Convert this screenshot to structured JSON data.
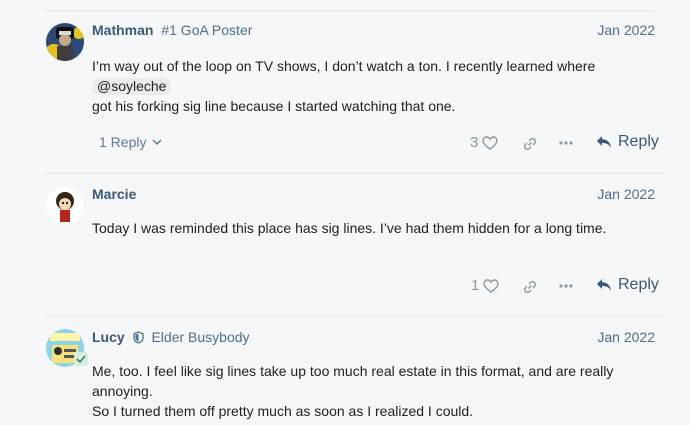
{
  "posts": [
    {
      "username": "Mathman",
      "user_title": "#1 GoA Poster",
      "date": "Jan 2022",
      "body_line1": "I’m way out of the loop on TV shows, I don’t watch a ton. I recently learned where",
      "mention": "@soyleche",
      "body_line2": "got his forking sig line because I started watching that one.",
      "replies_label": "1 Reply",
      "likes": "3",
      "reply_label": "Reply"
    },
    {
      "username": "Marcie",
      "date": "Jan 2022",
      "body": "Today I was reminded this place has sig lines. I’ve had them hidden for a long time.",
      "likes": "1",
      "reply_label": "Reply"
    },
    {
      "username": "Lucy",
      "user_title": "Elder Busybody",
      "date": "Jan 2022",
      "body_line1": "Me, too. I feel like sig lines take up too much real estate in this format, and are really annoying.",
      "body_line2": "So I turned them off pretty much as soon as I realized I could."
    }
  ],
  "icons": {
    "heart": "heart-icon",
    "link": "link-icon",
    "more": "more-icon",
    "reply": "reply-arrow-icon",
    "chevron": "chevron-down-icon",
    "shield": "shield-icon"
  },
  "colors": {
    "username": "#3b5a78",
    "muted": "#8899a8",
    "background": "#f5f7f9"
  }
}
